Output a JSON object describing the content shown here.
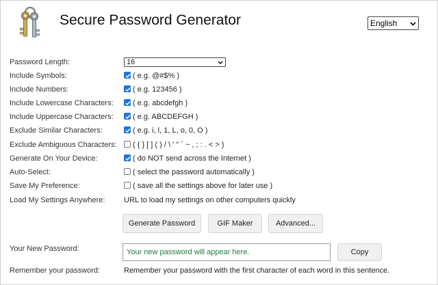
{
  "header": {
    "title": "Secure Password Generator",
    "language": "English",
    "logo_icon": "keys-icon"
  },
  "options": [
    {
      "label": "Password Length:",
      "control": "select",
      "value": "16"
    },
    {
      "label": "Include Symbols:",
      "control": "checkbox",
      "checked": true,
      "text": "( e.g. @#$% )"
    },
    {
      "label": "Include Numbers:",
      "control": "checkbox",
      "checked": true,
      "text": "( e.g. 123456 )"
    },
    {
      "label": "Include Lowercase Characters:",
      "control": "checkbox",
      "checked": true,
      "text": "( e.g. abcdefgh )"
    },
    {
      "label": "Include Uppercase Characters:",
      "control": "checkbox",
      "checked": true,
      "text": "( e.g. ABCDEFGH )"
    },
    {
      "label": "Exclude Similar Characters:",
      "control": "checkbox",
      "checked": true,
      "text": "( e.g. i, l, 1, L, o, 0, O )"
    },
    {
      "label": "Exclude Ambiguous Characters:",
      "control": "checkbox",
      "checked": false,
      "text": "( { } [ ] ( ) / \\ ' \" ` ~ , ; : . < > )"
    },
    {
      "label": "Generate On Your Device:",
      "control": "checkbox",
      "checked": true,
      "text": "( do NOT send across the Internet )"
    },
    {
      "label": "Auto-Select:",
      "control": "checkbox",
      "checked": false,
      "text": "( select the password automatically )"
    },
    {
      "label": "Save My Preference:",
      "control": "checkbox",
      "checked": false,
      "text": "( save all the settings above for later use )"
    },
    {
      "label": "Load My Settings Anywhere:",
      "control": "text",
      "text": "URL to load my settings on other computers quickly"
    }
  ],
  "buttons": {
    "generate": "Generate Password",
    "gif": "GIF Maker",
    "advanced": "Advanced..."
  },
  "output": {
    "label": "Your New Password:",
    "placeholder": "Your new password will appear here.",
    "copy": "Copy"
  },
  "remember": {
    "label": "Remember your password:",
    "text": "Remember your password with the first character of each word in this sentence."
  },
  "colors": {
    "checkbox_accent": "#1a73e8",
    "output_text": "#1f7a3d"
  }
}
